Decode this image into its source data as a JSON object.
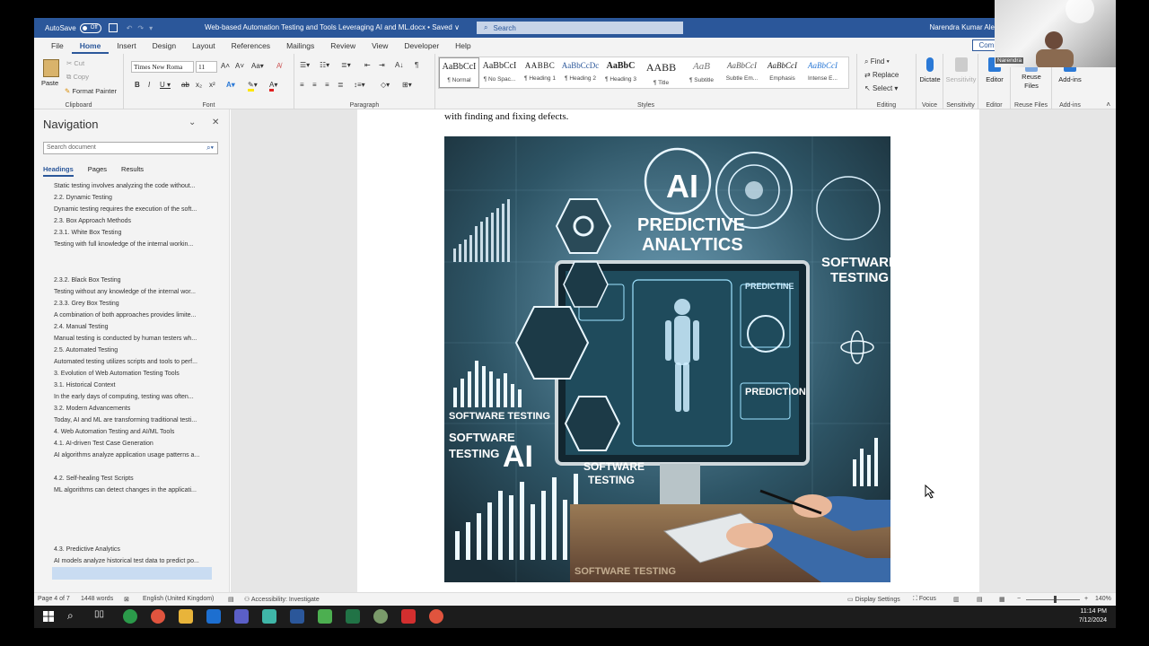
{
  "titlebar": {
    "autosave": "AutoSave",
    "autosave_state": "Off",
    "document_title": "Web-based Automation Testing and Tools Leveraging AI and ML.docx • Saved ∨",
    "search_placeholder": "Search",
    "user": "Narendra Kumar Ale"
  },
  "menu": {
    "tabs": [
      "File",
      "Home",
      "Insert",
      "Design",
      "Layout",
      "References",
      "Mailings",
      "Review",
      "View",
      "Developer",
      "Help"
    ],
    "comments": "Comm"
  },
  "ribbon": {
    "clipboard": {
      "paste": "Paste",
      "cut": "Cut",
      "copy": "Copy",
      "format_painter": "Format Painter",
      "label": "Clipboard"
    },
    "font": {
      "family": "Times New Roma",
      "size": "11",
      "label": "Font"
    },
    "paragraph": {
      "label": "Paragraph"
    },
    "styles": {
      "label": "Styles",
      "items": [
        {
          "sample": "AaBbCcI",
          "name": "¶ Normal"
        },
        {
          "sample": "AaBbCcI",
          "name": "¶ No Spac..."
        },
        {
          "sample": "AABBC",
          "name": "¶ Heading 1"
        },
        {
          "sample": "AaBbCcDc",
          "name": "¶ Heading 2"
        },
        {
          "sample": "AaBbC",
          "name": "¶ Heading 3"
        },
        {
          "sample": "AABB",
          "name": "¶ Title"
        },
        {
          "sample": "AaB",
          "name": "¶ Subtitle"
        },
        {
          "sample": "AaBbCcI",
          "name": "Subtle Em..."
        },
        {
          "sample": "AaBbCcI",
          "name": "Emphasis"
        },
        {
          "sample": "AaBbCcI",
          "name": "Intense E..."
        }
      ]
    },
    "editing": {
      "find": "Find",
      "replace": "Replace",
      "select": "Select",
      "label": "Editing"
    },
    "voice": {
      "dictate": "Dictate",
      "label": "Voice"
    },
    "sensitivity": {
      "button": "Sensitivity",
      "label": "Sensitivity"
    },
    "editor": {
      "button": "Editor",
      "label": "Editor"
    },
    "reuse": {
      "button_line1": "Reuse",
      "button_line2": "Files",
      "label": "Reuse Files"
    },
    "addins": {
      "button": "Add-ins",
      "label": "Add-ins"
    }
  },
  "navigation": {
    "title": "Navigation",
    "search_placeholder": "Search document",
    "tabs": [
      "Headings",
      "Pages",
      "Results"
    ],
    "items": [
      "Static testing involves analyzing the code without...",
      "2.2. Dynamic Testing",
      "Dynamic testing requires the execution of the soft...",
      "2.3. Box Approach Methods",
      "2.3.1. White Box Testing",
      "Testing with full knowledge of the internal workin...",
      "2.3.2. Black Box Testing",
      "Testing without any knowledge of the internal wor...",
      "2.3.3. Grey Box Testing",
      "A combination of both approaches provides limite...",
      "2.4. Manual Testing",
      "Manual testing is conducted by human testers wh...",
      "2.5. Automated Testing",
      "Automated testing utilizes scripts and tools to perf...",
      "3. Evolution of Web Automation Testing Tools",
      "3.1. Historical Context",
      "In the early days of computing, testing was often...",
      "3.2. Modern Advancements",
      "Today, AI and ML are transforming traditional testi...",
      "4. Web Automation Testing and AI/ML Tools",
      "4.1. AI-driven Test Case Generation",
      "AI algorithms analyze application usage patterns a...",
      "4.2. Self-healing Test Scripts",
      "ML algorithms can detect changes in the applicati...",
      "4.3. Predictive Analytics",
      "AI models analyze historical test data to predict po..."
    ]
  },
  "document": {
    "text_line": "with finding and fixing defects.",
    "image_text": {
      "ai": "AI",
      "predictive1": "PREDICTIVE",
      "predictive2": "ANALYTICS",
      "software_testing_right1": "SOFTWARE",
      "software_testing_right2": "TESTING",
      "software_testing_left": "SOFTWARE TESTING",
      "software_testing_ai1": "SOFTWARE",
      "software_testing_ai2": "TESTING",
      "ai2": "AI",
      "prediction": "PREDICTION",
      "screen_sw1": "SOFTWARE",
      "screen_sw2": "TESTING",
      "predictive_small": "PREDICTINE",
      "bottom": "SOFTWARE TESTING"
    }
  },
  "statusbar": {
    "page": "Page 4 of 7",
    "words": "1448 words",
    "language": "English (United Kingdom)",
    "accessibility": "Accessibility: Investigate",
    "display_settings": "Display Settings",
    "focus": "Focus",
    "zoom": "140%"
  },
  "taskbar": {
    "time": "11:14 PM",
    "date": "7/12/2024"
  },
  "webcam": {
    "label": "Narendra"
  }
}
